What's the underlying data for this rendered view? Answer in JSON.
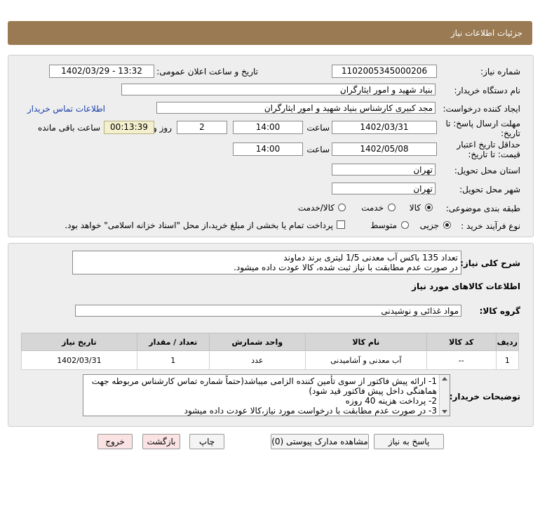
{
  "header": {
    "title": "جزئیات اطلاعات نیاز"
  },
  "form": {
    "need_number_label": "شماره نیاز:",
    "need_number": "1102005345000206",
    "announce_label": "تاریخ و ساعت اعلان عمومی:",
    "announce_value": "1402/03/29 - 13:32",
    "buyer_org_label": "نام دستگاه خریدار:",
    "buyer_org": "بنیاد شهید و امور ایثارگران",
    "requester_label": "ایجاد کننده درخواست:",
    "requester": "مجد کبیری کارشناس بنیاد شهید و امور ایثارگران",
    "contact_link": "اطلاعات تماس خریدار",
    "deadline_label_1": "مهلت ارسال پاسخ: تا",
    "deadline_label_2": "تاریخ:",
    "deadline_date": "1402/03/31",
    "time_label": "ساعت",
    "deadline_time": "14:00",
    "days_value": "2",
    "days_label": "روز و",
    "remaining_value": "00:13:39",
    "remaining_label": "ساعت باقی مانده",
    "validity_label_1": "حداقل تاریخ اعتبار",
    "validity_label_2": "قیمت: تا تاریخ:",
    "validity_date": "1402/05/08",
    "validity_time": "14:00",
    "province_label": "استان محل تحویل:",
    "province": "تهران",
    "city_label": "شهر محل تحویل:",
    "city": "تهران",
    "category_label": "طبقه بندی موضوعی:",
    "category_options": [
      "کالا",
      "خدمت",
      "کالا/خدمت"
    ],
    "category_selected": "کالا",
    "process_label": "نوع فرآیند خرید :",
    "process_options": [
      "جزیی",
      "متوسط"
    ],
    "process_selected": "جزیی",
    "payment_note": "پرداخت تمام یا بخشی از مبلغ خرید،از محل \"اسناد خزانه اسلامی\" خواهد بود."
  },
  "details": {
    "summary_label": "شرح کلی نیاز:",
    "summary_line1": "تعداد 135 باکس آب معدنی 1/5 لیتری برند دماوند",
    "summary_line2": "در صورت عدم مطابقت با نیاز ثبت شده، کالا عودت داده میشود.",
    "goods_info_title": "اطلاعات کالاهای مورد نیاز",
    "goods_group_label": "گروه کالا:",
    "goods_group": "مواد غذائی و نوشیدنی",
    "table": {
      "headers": [
        "ردیف",
        "کد کالا",
        "نام کالا",
        "واحد شمارش",
        "تعداد / مقدار",
        "تاریخ نیاز"
      ],
      "rows": [
        [
          "1",
          "--",
          "آب معدنی و آشامیدنی",
          "عدد",
          "1",
          "1402/03/31"
        ]
      ]
    },
    "buyer_notes_label": "توضیحات خریدار:",
    "buyer_notes": [
      "1- ارائه پیش فاکتور از سوی تأمین کننده الزامی میباشد(حتماً شماره تماس کارشناس مربوطه جهت",
      "هماهنگی داخل پیش فاکتور قید شود)",
      "2- پرداخت هزینه 40 روزه",
      "3- در صورت عدم مطابقت با درخواست مورد نیاز،کالا عودت داده میشود"
    ]
  },
  "buttons": {
    "reply": "پاسخ به نیاز",
    "attachments": "مشاهده مدارک پیوستی (0)",
    "print": "چاپ",
    "back": "بازگشت",
    "exit": "خروج"
  }
}
